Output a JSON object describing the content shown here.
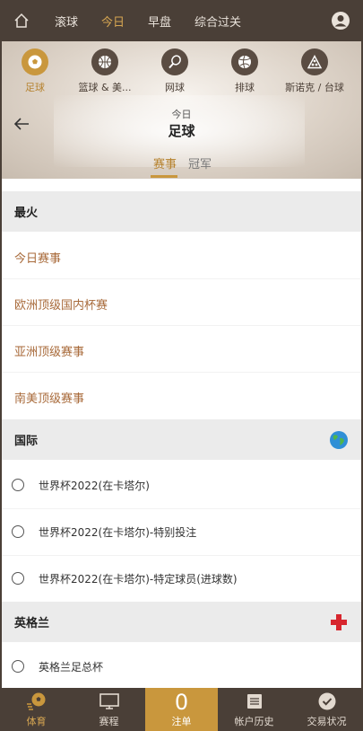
{
  "topnav": {
    "tabs": [
      {
        "label": "滚球"
      },
      {
        "label": "今日"
      },
      {
        "label": "早盘"
      },
      {
        "label": "综合过关"
      }
    ],
    "active_tab": "今日",
    "icons": {
      "home": "home-icon",
      "user": "user-icon"
    }
  },
  "sports": [
    {
      "label": "足球",
      "icon": "soccer-ball-icon"
    },
    {
      "label": "篮球 & 美...",
      "icon": "basketball-icon"
    },
    {
      "label": "网球",
      "icon": "tennis-icon"
    },
    {
      "label": "排球",
      "icon": "volleyball-icon"
    },
    {
      "label": "斯诺克 / 台球",
      "icon": "billiards-icon"
    }
  ],
  "header": {
    "subtitle": "今日",
    "title": "足球",
    "segments": [
      "赛事",
      "冠军"
    ]
  },
  "hot": {
    "heading": "最火",
    "links": [
      "今日赛事",
      "欧洲顶级国内杯赛",
      "亚洲顶级赛事",
      "南美顶级赛事"
    ]
  },
  "international": {
    "heading": "国际",
    "flag_icon": "globe-icon",
    "items": [
      "世界杯2022(在卡塔尔)",
      "世界杯2022(在卡塔尔)-特别投注",
      "世界杯2022(在卡塔尔)-特定球员(进球数)"
    ]
  },
  "england": {
    "heading": "英格兰",
    "flag_icon": "england-flag-icon",
    "items": [
      "英格兰足总杯"
    ]
  },
  "bottombar": {
    "items": [
      {
        "label": "体育"
      },
      {
        "label": "赛程"
      },
      {
        "label": "注单",
        "count": "0"
      },
      {
        "label": "帐户历史"
      },
      {
        "label": "交易状况"
      }
    ]
  },
  "colors": {
    "brand_dark": "#4a3f37",
    "accent_gold": "#c9973d",
    "link_brown": "#a86a3a"
  }
}
